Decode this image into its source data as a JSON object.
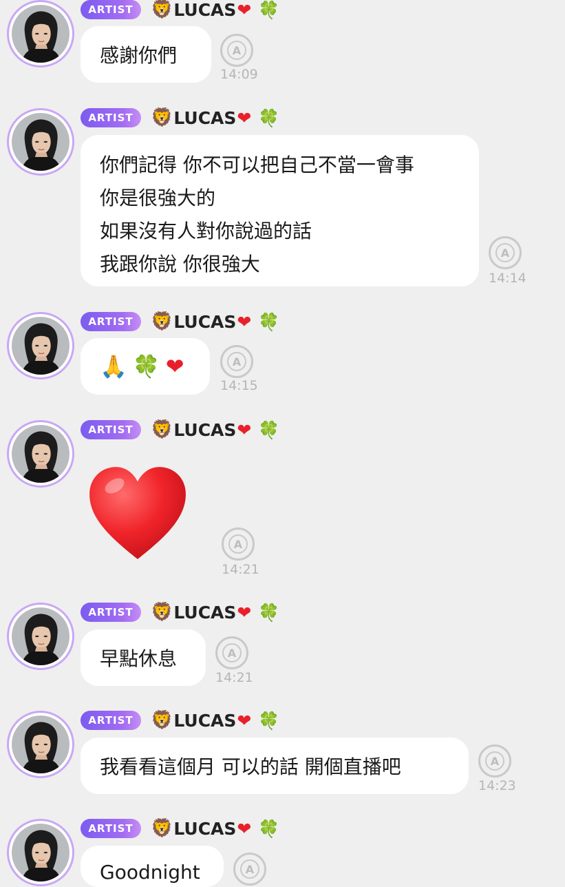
{
  "artist_badge": "ARTIST",
  "sender": {
    "lion": "🦁",
    "name": "LUCAS",
    "heart": "❤",
    "clover": "🍀"
  },
  "translate_glyph": "A",
  "messages": [
    {
      "lines": [
        "感謝你們"
      ],
      "time": "14:09"
    },
    {
      "lines": [
        "你們記得 你不可以把自己不當一會事",
        "你是很強大的",
        "如果沒有人對你說過的話",
        "我跟你說 你很強大"
      ],
      "time": "14:14"
    },
    {
      "emoji": [
        "🙏",
        "🍀",
        "❤"
      ],
      "time": "14:15"
    },
    {
      "big_heart": "❤",
      "time": "14:21"
    },
    {
      "lines": [
        "早點休息"
      ],
      "time": "14:21"
    },
    {
      "lines": [
        "我看看這個月 可以的話 開個直播吧"
      ],
      "time": "14:23"
    },
    {
      "lines": [
        "Goodnight"
      ],
      "time": ""
    }
  ],
  "colors": {
    "background": "#efefef",
    "bubble": "#ffffff",
    "badge_start": "#7b5cf0",
    "badge_end": "#c58ef5",
    "avatar_ring": "#c9a7f5",
    "heart": "#e8202a",
    "clover": "#3fae3a",
    "timestamp": "#b5b5b5"
  },
  "icons": {
    "avatar": "artist-avatar-photo",
    "translate": "translate-icon"
  }
}
